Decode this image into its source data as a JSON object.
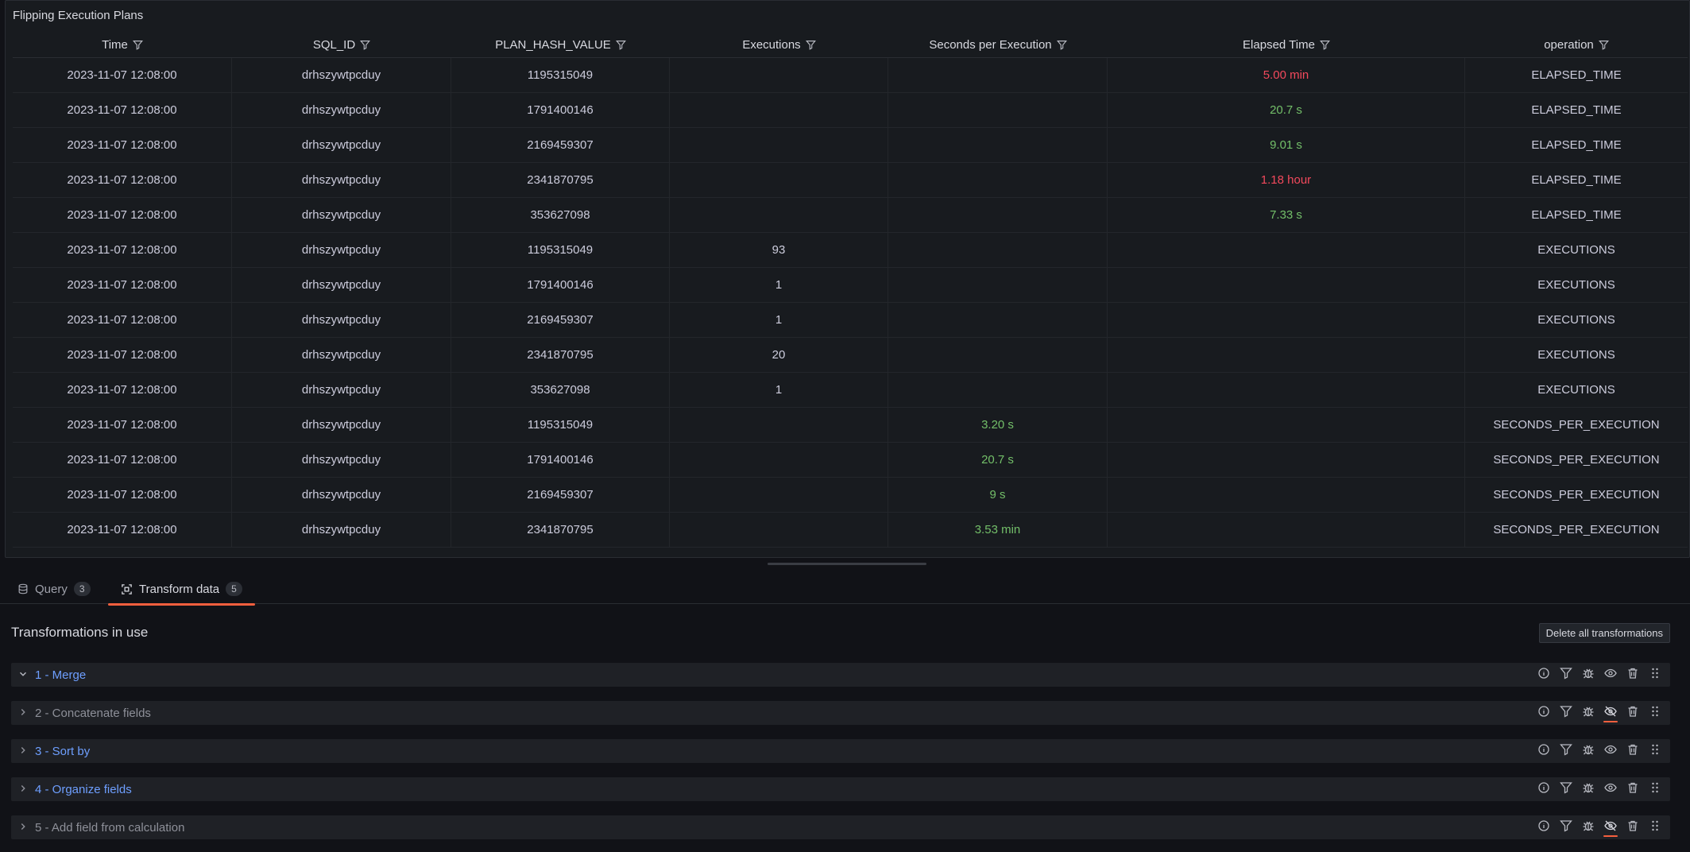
{
  "panel": {
    "title": "Flipping Execution Plans"
  },
  "table": {
    "columns": [
      "Time",
      "SQL_ID",
      "PLAN_HASH_VALUE",
      "Executions",
      "Seconds per Execution",
      "Elapsed Time",
      "operation"
    ],
    "rows": [
      {
        "time": "2023-11-07 12:08:00",
        "sql_id": "drhszywtpcduy",
        "plan": "1195315049",
        "exec": "",
        "spe": "",
        "elapsed": "5.00 min",
        "elapsed_status": "bad",
        "spe_status": "",
        "op": "ELAPSED_TIME"
      },
      {
        "time": "2023-11-07 12:08:00",
        "sql_id": "drhszywtpcduy",
        "plan": "1791400146",
        "exec": "",
        "spe": "",
        "elapsed": "20.7 s",
        "elapsed_status": "good",
        "spe_status": "",
        "op": "ELAPSED_TIME"
      },
      {
        "time": "2023-11-07 12:08:00",
        "sql_id": "drhszywtpcduy",
        "plan": "2169459307",
        "exec": "",
        "spe": "",
        "elapsed": "9.01 s",
        "elapsed_status": "good",
        "spe_status": "",
        "op": "ELAPSED_TIME"
      },
      {
        "time": "2023-11-07 12:08:00",
        "sql_id": "drhszywtpcduy",
        "plan": "2341870795",
        "exec": "",
        "spe": "",
        "elapsed": "1.18 hour",
        "elapsed_status": "bad",
        "spe_status": "",
        "op": "ELAPSED_TIME"
      },
      {
        "time": "2023-11-07 12:08:00",
        "sql_id": "drhszywtpcduy",
        "plan": "353627098",
        "exec": "",
        "spe": "",
        "elapsed": "7.33 s",
        "elapsed_status": "good",
        "spe_status": "",
        "op": "ELAPSED_TIME"
      },
      {
        "time": "2023-11-07 12:08:00",
        "sql_id": "drhszywtpcduy",
        "plan": "1195315049",
        "exec": "93",
        "spe": "",
        "elapsed": "",
        "elapsed_status": "",
        "spe_status": "",
        "op": "EXECUTIONS"
      },
      {
        "time": "2023-11-07 12:08:00",
        "sql_id": "drhszywtpcduy",
        "plan": "1791400146",
        "exec": "1",
        "spe": "",
        "elapsed": "",
        "elapsed_status": "",
        "spe_status": "",
        "op": "EXECUTIONS"
      },
      {
        "time": "2023-11-07 12:08:00",
        "sql_id": "drhszywtpcduy",
        "plan": "2169459307",
        "exec": "1",
        "spe": "",
        "elapsed": "",
        "elapsed_status": "",
        "spe_status": "",
        "op": "EXECUTIONS"
      },
      {
        "time": "2023-11-07 12:08:00",
        "sql_id": "drhszywtpcduy",
        "plan": "2341870795",
        "exec": "20",
        "spe": "",
        "elapsed": "",
        "elapsed_status": "",
        "spe_status": "",
        "op": "EXECUTIONS"
      },
      {
        "time": "2023-11-07 12:08:00",
        "sql_id": "drhszywtpcduy",
        "plan": "353627098",
        "exec": "1",
        "spe": "",
        "elapsed": "",
        "elapsed_status": "",
        "spe_status": "",
        "op": "EXECUTIONS"
      },
      {
        "time": "2023-11-07 12:08:00",
        "sql_id": "drhszywtpcduy",
        "plan": "1195315049",
        "exec": "",
        "spe": "3.20 s",
        "elapsed": "",
        "elapsed_status": "",
        "spe_status": "good",
        "op": "SECONDS_PER_EXECUTION"
      },
      {
        "time": "2023-11-07 12:08:00",
        "sql_id": "drhszywtpcduy",
        "plan": "1791400146",
        "exec": "",
        "spe": "20.7 s",
        "elapsed": "",
        "elapsed_status": "",
        "spe_status": "good",
        "op": "SECONDS_PER_EXECUTION"
      },
      {
        "time": "2023-11-07 12:08:00",
        "sql_id": "drhszywtpcduy",
        "plan": "2169459307",
        "exec": "",
        "spe": "9 s",
        "elapsed": "",
        "elapsed_status": "",
        "spe_status": "good",
        "op": "SECONDS_PER_EXECUTION"
      },
      {
        "time": "2023-11-07 12:08:00",
        "sql_id": "drhszywtpcduy",
        "plan": "2341870795",
        "exec": "",
        "spe": "3.53 min",
        "elapsed": "",
        "elapsed_status": "",
        "spe_status": "good",
        "op": "SECONDS_PER_EXECUTION"
      }
    ]
  },
  "tabs": [
    {
      "label": "Query",
      "count": "3",
      "icon": "database-icon",
      "active": false
    },
    {
      "label": "Transform data",
      "count": "5",
      "icon": "transform-icon",
      "active": true
    }
  ],
  "transformations": {
    "title": "Transformations in use",
    "delete_label": "Delete all transformations",
    "items": [
      {
        "label": "1 - Merge",
        "enabled": true,
        "expanded": true
      },
      {
        "label": "2 - Concatenate fields",
        "enabled": false,
        "expanded": false
      },
      {
        "label": "3 - Sort by",
        "enabled": true,
        "expanded": false
      },
      {
        "label": "4 - Organize fields",
        "enabled": true,
        "expanded": false
      },
      {
        "label": "5 - Add field from calculation",
        "enabled": false,
        "expanded": false
      }
    ]
  },
  "colors": {
    "good": "#73bf69",
    "bad": "#f2495c",
    "accent": "#f55f3e",
    "link": "#6e9fff"
  }
}
